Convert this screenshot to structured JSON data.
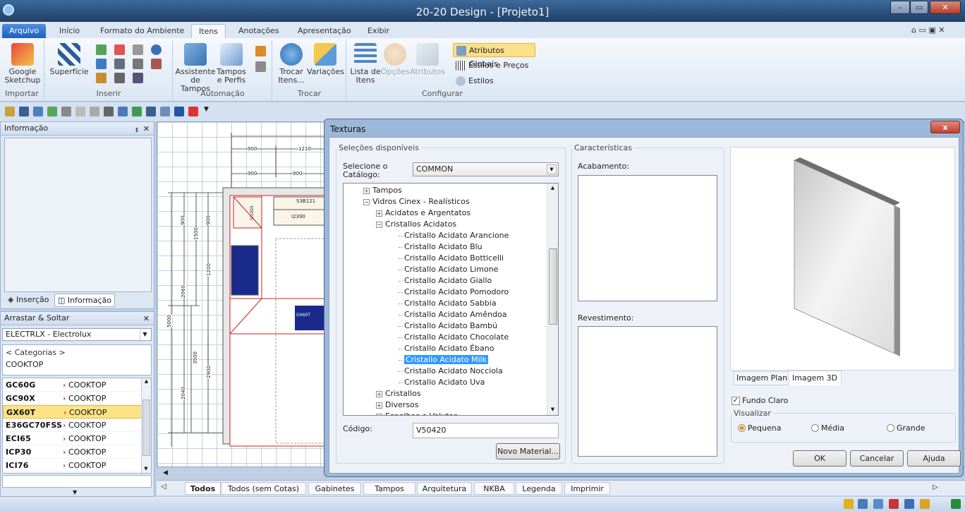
{
  "window": {
    "title": "20-20 Design - [Projeto1]",
    "min": "–",
    "max": "▭",
    "close": "✕"
  },
  "ribbon_tabs": [
    "Arquivo",
    "Início",
    "Formato do Ambiente",
    "Itens",
    "Anotações",
    "Apresentação",
    "Exibir"
  ],
  "ribbon": {
    "importar": {
      "label": "Importar",
      "sketchup": "Google Sketchup"
    },
    "inserir": {
      "label": "Inserir",
      "superficie": "Superfície"
    },
    "automacao": {
      "label": "Automação",
      "assistente": "Assistente de Tampos",
      "tampos": "Tampos e Perfis"
    },
    "trocar": {
      "label": "Trocar",
      "trocar_itens": "Trocar Itens...",
      "variacoes": "Variações"
    },
    "configurar": {
      "label": "Configurar",
      "lista": "Lista de Itens",
      "opcoes": "Opções",
      "atributos": "Atributos",
      "globais": "Atributos Globais",
      "estilos_precos": "Estilos e Preços",
      "estilos": "Estilos"
    }
  },
  "info_panel": {
    "title": "Informação",
    "tab_insercao": "Inserção",
    "tab_informacao": "Informação"
  },
  "drag_panel": {
    "title": "Arrastar & Soltar",
    "catalog": "ELECTRLX - Electrolux",
    "categories": "< Categorias >",
    "category": "COOKTOP"
  },
  "products": [
    {
      "code": "GC60G",
      "cat": "COOKTOP"
    },
    {
      "code": "GC90X",
      "cat": "COOKTOP"
    },
    {
      "code": "GX60T",
      "cat": "COOKTOP"
    },
    {
      "code": "E36GC70FSS",
      "cat": "COOKTOP"
    },
    {
      "code": "ECI65",
      "cat": "COOKTOP"
    },
    {
      "code": "ICP30",
      "cat": "COOKTOP"
    },
    {
      "code": "ICI76",
      "cat": "COOKTOP"
    }
  ],
  "plan": {
    "dims_top": [
      "900",
      "1210",
      "900",
      "900"
    ],
    "dims_left_outer": [
      "5000"
    ],
    "dims_left": [
      "900",
      "2060",
      "3500",
      "2040"
    ],
    "dims_left_inner": [
      "900",
      "1500",
      "1200",
      "2900"
    ],
    "labels": [
      "S3B121",
      "I2390",
      "I21005",
      "GX60T"
    ]
  },
  "bottom_tabs": [
    "Todos",
    "Todos (sem Cotas)",
    "Gabinetes",
    "Tampos",
    "Arquitetura",
    "NKBA",
    "Legenda",
    "Imprimir"
  ],
  "dialog": {
    "title": "Texturas",
    "close": "x",
    "available_legend": "Seleções disponíveis",
    "select_catalog_label": "Selecione o Catálogo:",
    "catalog_value": "COMMON",
    "tree": [
      {
        "label": "Tampos",
        "level": 1,
        "exp": "+"
      },
      {
        "label": "Vidros Cinex - Realísticos",
        "level": 1,
        "exp": "−"
      },
      {
        "label": "Acidatos e Argentatos",
        "level": 2,
        "exp": "+"
      },
      {
        "label": "Cristallos Acidatos",
        "level": 2,
        "exp": "−"
      },
      {
        "label": "Cristallo Acidato Arancione",
        "level": 3
      },
      {
        "label": "Cristallo Acidato Blu",
        "level": 3
      },
      {
        "label": "Cristallo Acidato Botticelli",
        "level": 3
      },
      {
        "label": "Cristallo Acidato Limone",
        "level": 3
      },
      {
        "label": "Cristallo Acidato Giallo",
        "level": 3
      },
      {
        "label": "Cristallo Acidato Pomodoro",
        "level": 3
      },
      {
        "label": "Cristallo Acidato Sabbia",
        "level": 3
      },
      {
        "label": "Cristallo Acidato Amêndoa",
        "level": 3
      },
      {
        "label": "Cristallo Acidato Bambú",
        "level": 3
      },
      {
        "label": "Cristallo Acidato Chocolate",
        "level": 3
      },
      {
        "label": "Cristallo Acidato Ébano",
        "level": 3
      },
      {
        "label": "Cristallo Acidato Milk",
        "level": 3,
        "selected": true
      },
      {
        "label": "Cristallo Acidato Nocciola",
        "level": 3
      },
      {
        "label": "Cristallo Acidato Uva",
        "level": 3
      },
      {
        "label": "Cristallos",
        "level": 2,
        "exp": "+"
      },
      {
        "label": "Diversos",
        "level": 2,
        "exp": "+"
      },
      {
        "label": "Espelhos e Volutos",
        "level": 2,
        "exp": "+"
      }
    ],
    "code_label": "Código:",
    "code_value": "V50420",
    "new_material": "Novo Material...",
    "features_legend": "Características",
    "finish_label": "Acabamento:",
    "coating_label": "Revestimento:",
    "tab_flat": "Imagem Plana",
    "tab_3d": "Imagem 3D",
    "light_bg": "Fundo Claro",
    "view_legend": "Visualizar",
    "view_small": "Pequena",
    "view_medium": "Média",
    "view_large": "Grande",
    "ok": "OK",
    "cancel": "Cancelar",
    "help": "Ajuda"
  }
}
